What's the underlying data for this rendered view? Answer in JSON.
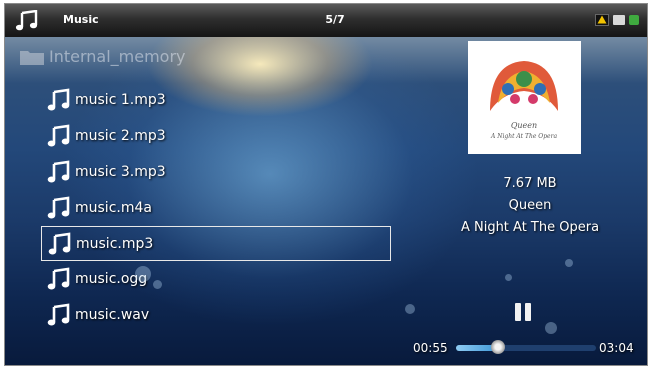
{
  "topbar": {
    "app_title": "Music",
    "track_position": "5/7",
    "icon": "music-note-icon"
  },
  "folder": {
    "label": "Internal_memory",
    "icon": "folder-icon"
  },
  "files": [
    {
      "name": "music 1.mp3"
    },
    {
      "name": "music 2.mp3"
    },
    {
      "name": "music 3.mp3"
    },
    {
      "name": "music.m4a"
    },
    {
      "name": "music.mp3",
      "selected": true
    },
    {
      "name": "music.ogg"
    },
    {
      "name": "music.wav"
    }
  ],
  "now_playing": {
    "size": "7.67 MB",
    "artist": "Queen",
    "album": "A Night At The Opera",
    "album_art_text": [
      "Queen",
      "A Night At The Opera"
    ]
  },
  "playback": {
    "elapsed": "00:55",
    "total": "03:04",
    "progress": 0.3,
    "state_icon": "pause-icon"
  },
  "colors": {
    "accent": "#3f98d8",
    "topbar": "#2e2e2e"
  }
}
